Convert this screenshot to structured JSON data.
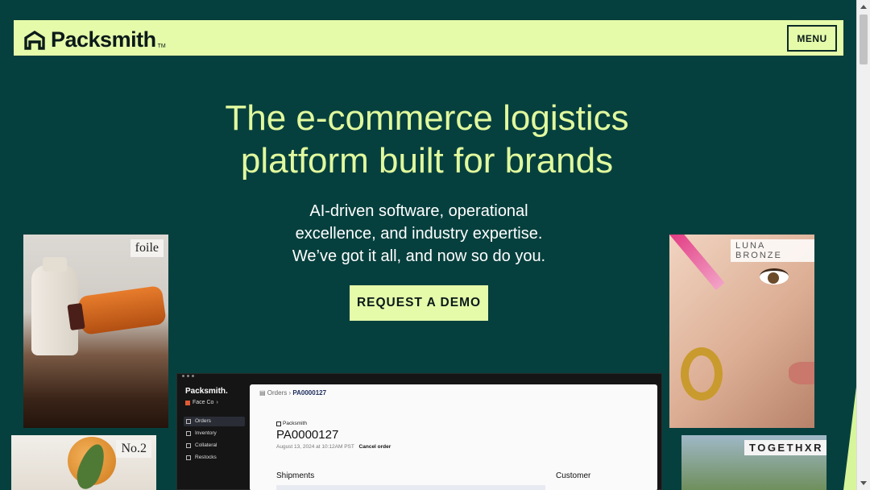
{
  "header": {
    "logo_text": "Packsmith",
    "logo_tm": "TM",
    "menu_label": "MENU"
  },
  "hero": {
    "title_line1": "The e-commerce logistics",
    "title_line2": "platform built for brands",
    "subtitle_line1": "AI-driven software, operational",
    "subtitle_line2": "excellence, and industry expertise.",
    "subtitle_line3": "We’ve got it all, and now so do you.",
    "cta_label": "REQUEST A DEMO"
  },
  "brand_cards": {
    "foile": "foile",
    "no2": "No.2",
    "luna": "LUNA BRONZE",
    "together": "TOGETHXR"
  },
  "app_preview": {
    "brand": "Packsmith.",
    "org": "Face Co",
    "nav": [
      "Orders",
      "Inventory",
      "Collateral",
      "Restocks"
    ],
    "breadcrumb_parent": "Orders",
    "breadcrumb_current": "PA0000127",
    "doc_brand": "Packsmith",
    "order_id": "PA0000127",
    "order_date": "August 13, 2024 at 10:12AM PST",
    "cancel_label": "Cancel order",
    "shipments_heading": "Shipments",
    "customer_heading": "Customer"
  },
  "colors": {
    "background": "#06403e",
    "accent": "#e5fbaa",
    "title": "#e1f99e"
  }
}
